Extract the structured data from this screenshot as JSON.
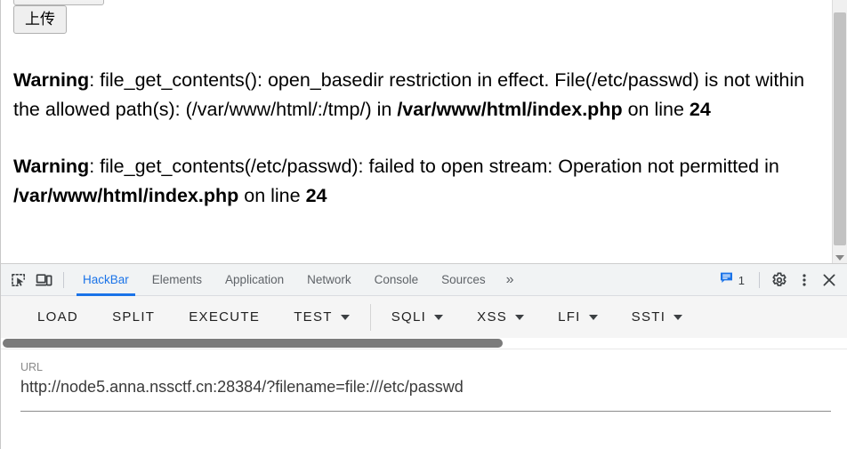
{
  "page": {
    "file_chooser_button_label": "",
    "upload_button_label": "上传",
    "warnings": [
      {
        "label": "Warning",
        "text": ": file_get_contents(): open_basedir restriction in effect. File(/etc/passwd) is not within the allowed path(s): (/var/www/html/:/tmp/) in ",
        "file": "/var/www/html/index.php",
        "on_line_text": " on line ",
        "line": "24"
      },
      {
        "label": "Warning",
        "text": ": file_get_contents(/etc/passwd): failed to open stream: Operation not permitted in ",
        "file": "/var/www/html/index.php",
        "on_line_text": " on line ",
        "line": "24"
      }
    ]
  },
  "devtools": {
    "inspect_icon": "inspect-element-icon",
    "device_toolbar_icon": "device-toolbar-icon",
    "tabs": [
      {
        "label": "HackBar",
        "active": true
      },
      {
        "label": "Elements",
        "active": false
      },
      {
        "label": "Application",
        "active": false
      },
      {
        "label": "Network",
        "active": false
      },
      {
        "label": "Console",
        "active": false
      },
      {
        "label": "Sources",
        "active": false
      }
    ],
    "more_tabs_glyph": "»",
    "issues_count": "1",
    "issues_icon": "message-bubble-icon",
    "settings_icon": "gear-icon",
    "menu_icon": "kebab-menu-icon",
    "close_icon": "close-icon",
    "accent_color": "#1a73e8",
    "tabbar_background": "#f1f3f4"
  },
  "hackbar": {
    "buttons": [
      {
        "label": "LOAD",
        "has_dropdown": false
      },
      {
        "label": "SPLIT",
        "has_dropdown": false
      },
      {
        "label": "EXECUTE",
        "has_dropdown": false
      },
      {
        "label": "TEST",
        "has_dropdown": true
      },
      {
        "label": "SQLI",
        "has_dropdown": true
      },
      {
        "label": "XSS",
        "has_dropdown": true
      },
      {
        "label": "LFI",
        "has_dropdown": true
      },
      {
        "label": "SSTI",
        "has_dropdown": true
      }
    ],
    "url_label": "URL",
    "url_value": "http://node5.anna.nssctf.cn:28384/?filename=file:///etc/passwd"
  }
}
